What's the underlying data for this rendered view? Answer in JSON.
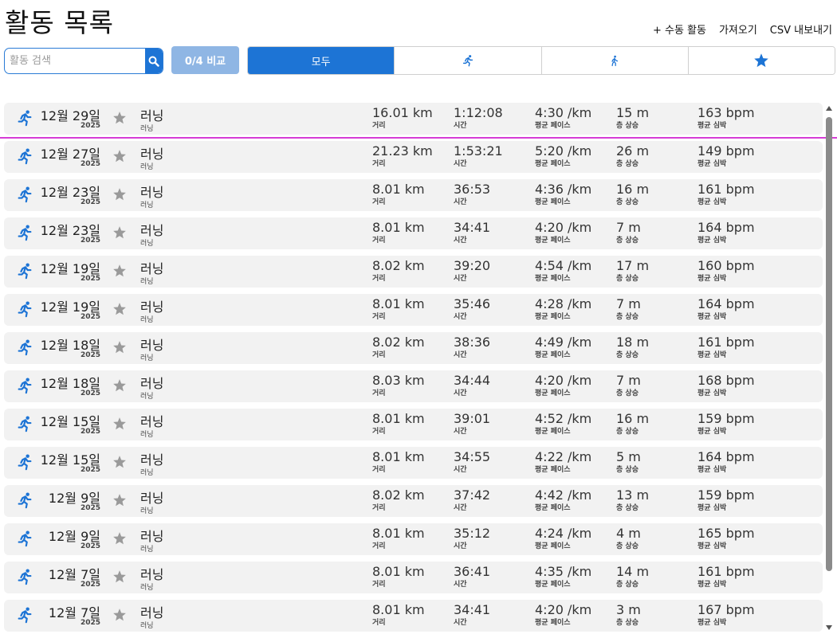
{
  "header": {
    "title": "활동 목록",
    "actions": [
      "+ 수동 활동",
      "가져오기",
      "CSV 내보내기"
    ]
  },
  "toolbar": {
    "search_placeholder": "활동 검색",
    "compare_label": "0/4 비교",
    "filters": [
      {
        "label": "모두",
        "icon": null,
        "active": true
      },
      {
        "label": "",
        "icon": "running-icon",
        "active": false
      },
      {
        "label": "",
        "icon": "walking-icon",
        "active": false
      },
      {
        "label": "",
        "icon": "star-icon",
        "active": false
      }
    ]
  },
  "labels": {
    "distance": "거리",
    "time": "시간",
    "pace": "평균 페이스",
    "elevation": "층 상승",
    "heart_rate": "평균 심박"
  },
  "activities": [
    {
      "date": "12월 29일",
      "year": "2025",
      "name": "러닝",
      "type": "러닝",
      "distance": "16.01 km",
      "time": "1:12:08",
      "pace": "4:30 /km",
      "elevation": "15 m",
      "heart_rate": "163 bpm"
    },
    {
      "date": "12월 27일",
      "year": "2025",
      "name": "러닝",
      "type": "러닝",
      "distance": "21.23 km",
      "time": "1:53:21",
      "pace": "5:20 /km",
      "elevation": "26 m",
      "heart_rate": "149 bpm"
    },
    {
      "date": "12월 23일",
      "year": "2025",
      "name": "러닝",
      "type": "러닝",
      "distance": "8.01 km",
      "time": "36:53",
      "pace": "4:36 /km",
      "elevation": "16 m",
      "heart_rate": "161 bpm"
    },
    {
      "date": "12월 23일",
      "year": "2025",
      "name": "러닝",
      "type": "러닝",
      "distance": "8.01 km",
      "time": "34:41",
      "pace": "4:20 /km",
      "elevation": "7 m",
      "heart_rate": "164 bpm"
    },
    {
      "date": "12월 19일",
      "year": "2025",
      "name": "러닝",
      "type": "러닝",
      "distance": "8.02 km",
      "time": "39:20",
      "pace": "4:54 /km",
      "elevation": "17 m",
      "heart_rate": "160 bpm"
    },
    {
      "date": "12월 19일",
      "year": "2025",
      "name": "러닝",
      "type": "러닝",
      "distance": "8.01 km",
      "time": "35:46",
      "pace": "4:28 /km",
      "elevation": "7 m",
      "heart_rate": "164 bpm"
    },
    {
      "date": "12월 18일",
      "year": "2025",
      "name": "러닝",
      "type": "러닝",
      "distance": "8.02 km",
      "time": "38:36",
      "pace": "4:49 /km",
      "elevation": "18 m",
      "heart_rate": "161 bpm"
    },
    {
      "date": "12월 18일",
      "year": "2025",
      "name": "러닝",
      "type": "러닝",
      "distance": "8.03 km",
      "time": "34:44",
      "pace": "4:20 /km",
      "elevation": "7 m",
      "heart_rate": "168 bpm"
    },
    {
      "date": "12월 15일",
      "year": "2025",
      "name": "러닝",
      "type": "러닝",
      "distance": "8.01 km",
      "time": "39:01",
      "pace": "4:52 /km",
      "elevation": "16 m",
      "heart_rate": "159 bpm"
    },
    {
      "date": "12월 15일",
      "year": "2025",
      "name": "러닝",
      "type": "러닝",
      "distance": "8.01 km",
      "time": "34:55",
      "pace": "4:22 /km",
      "elevation": "5 m",
      "heart_rate": "164 bpm"
    },
    {
      "date": "12월 9일",
      "year": "2025",
      "name": "러닝",
      "type": "러닝",
      "distance": "8.02 km",
      "time": "37:42",
      "pace": "4:42 /km",
      "elevation": "13 m",
      "heart_rate": "159 bpm"
    },
    {
      "date": "12월 9일",
      "year": "2025",
      "name": "러닝",
      "type": "러닝",
      "distance": "8.01 km",
      "time": "35:12",
      "pace": "4:24 /km",
      "elevation": "4 m",
      "heart_rate": "165 bpm"
    },
    {
      "date": "12월 7일",
      "year": "2025",
      "name": "러닝",
      "type": "러닝",
      "distance": "8.01 km",
      "time": "36:41",
      "pace": "4:35 /km",
      "elevation": "14 m",
      "heart_rate": "161 bpm"
    },
    {
      "date": "12월 7일",
      "year": "2025",
      "name": "러닝",
      "type": "러닝",
      "distance": "8.01 km",
      "time": "34:41",
      "pace": "4:20 /km",
      "elevation": "3 m",
      "heart_rate": "167 bpm"
    }
  ],
  "colors": {
    "accent": "#1d74d5",
    "compare_button": "#8fb6e4",
    "row_background": "#f2f2f2",
    "star_inactive": "#9a9a9a",
    "guide_line": "#d63cd6"
  }
}
